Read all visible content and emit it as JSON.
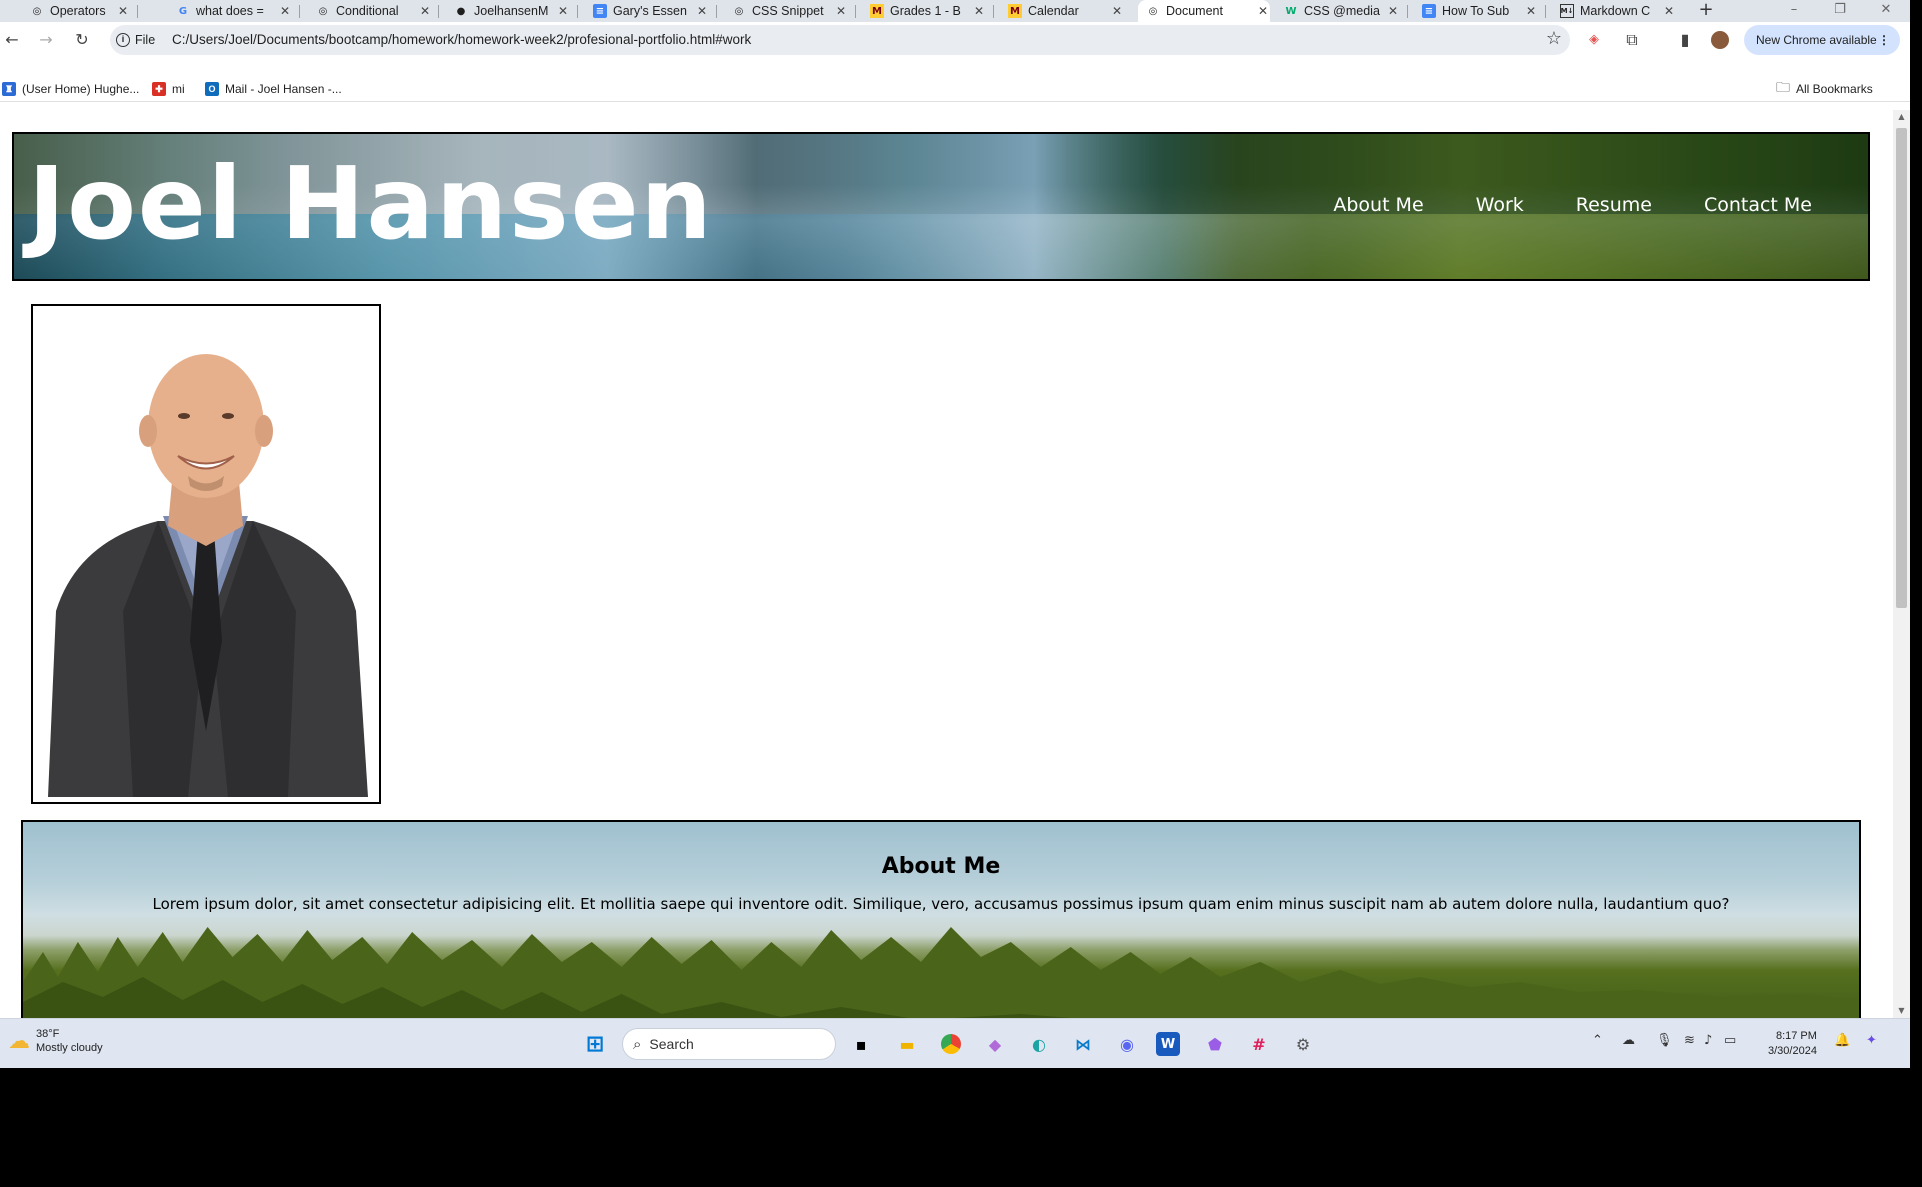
{
  "browser": {
    "tabs": [
      {
        "title": "Operators",
        "icon": "globe-icon"
      },
      {
        "title": "what does =",
        "icon": "google-icon"
      },
      {
        "title": "Conditional",
        "icon": "globe-icon"
      },
      {
        "title": "JoelhansenM",
        "icon": "github-icon"
      },
      {
        "title": "Gary's Essen",
        "icon": "docs-icon"
      },
      {
        "title": "CSS Snippet",
        "icon": "globe-icon"
      },
      {
        "title": "Grades 1 - B",
        "icon": "umn-icon"
      },
      {
        "title": "Calendar",
        "icon": "umn-icon"
      },
      {
        "title": "Document",
        "icon": "globe-icon",
        "active": true
      },
      {
        "title": "CSS @media",
        "icon": "w3-icon"
      },
      {
        "title": "How To Sub",
        "icon": "docs-icon"
      },
      {
        "title": "Markdown C",
        "icon": "markdown-icon"
      }
    ],
    "new_tab": "+",
    "window_controls": {
      "minimize": "–",
      "restore": "❐",
      "close": "✕"
    },
    "url_chip": "File",
    "url": "C:/Users/Joel/Documents/bootcamp/homework/homework-week2/profesional-portfolio.html#work",
    "update_button": "New Chrome available",
    "bookmarks": [
      {
        "label": "(User Home) Hughe...",
        "icon": "bookmark-site-icon",
        "color": "#2c6bd6"
      },
      {
        "label": "mi",
        "icon": "bookmark-site-icon",
        "color": "#d93025"
      },
      {
        "label": "Mail - Joel Hansen -...",
        "icon": "outlook-icon",
        "color": "#0f6cbd"
      }
    ],
    "all_bookmarks": "All Bookmarks"
  },
  "page": {
    "brand": "Joel Hansen",
    "nav": [
      "About Me",
      "Work",
      "Resume",
      "Contact Me"
    ],
    "about": {
      "heading": "About Me",
      "text": "Lorem ipsum dolor, sit amet consectetur adipisicing elit. Et mollitia saepe qui inventore odit. Similique, vero, accusamus possimus ipsum quam enim minus suscipit nam ab autem dolore nulla, laudantium quo?"
    }
  },
  "taskbar": {
    "weather_temp": "38°F",
    "weather_desc": "Mostly cloudy",
    "search_label": "Search",
    "time": "8:17 PM",
    "date": "3/30/2024"
  },
  "colors": {
    "tabstrip": "#dfe3ea",
    "update_button": "#d3e3fd",
    "taskbar": "#dfe6f1"
  }
}
